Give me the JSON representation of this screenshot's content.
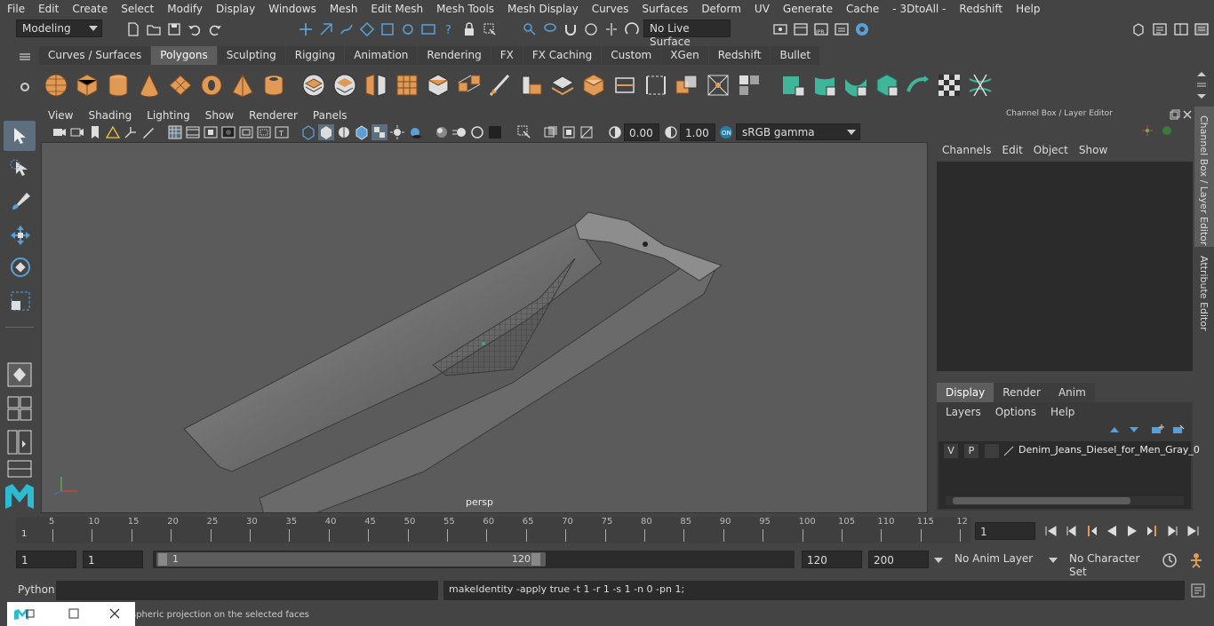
{
  "menubar": {
    "items": [
      "File",
      "Edit",
      "Create",
      "Select",
      "Modify",
      "Display",
      "Windows",
      "Mesh",
      "Edit Mesh",
      "Mesh Tools",
      "Mesh Display",
      "Curves",
      "Surfaces",
      "Deform",
      "UV",
      "Generate",
      "Cache",
      "- 3DtoAll -",
      "Redshift",
      "Help"
    ]
  },
  "toolbar": {
    "mode": "Modeling",
    "live_surface": "No Live Surface"
  },
  "shelf": {
    "tabs": [
      "Curves / Surfaces",
      "Polygons",
      "Sculpting",
      "Rigging",
      "Animation",
      "Rendering",
      "FX",
      "FX Caching",
      "Custom",
      "XGen",
      "Redshift",
      "Bullet"
    ],
    "active": "Polygons"
  },
  "viewport": {
    "menu": [
      "View",
      "Shading",
      "Lighting",
      "Show",
      "Renderer",
      "Panels"
    ],
    "exposure": "0.00",
    "gamma": "1.00",
    "colorspace": "sRGB gamma",
    "camera_label": "persp"
  },
  "channel_box": {
    "title": "Channel Box / Layer Editor",
    "menu": [
      "Channels",
      "Edit",
      "Object",
      "Show"
    ],
    "side_tabs": [
      "Channel Box / Layer Editor",
      "Attribute Editor"
    ]
  },
  "layer_editor": {
    "tabs": [
      "Display",
      "Render",
      "Anim"
    ],
    "active_tab": "Display",
    "menu": [
      "Layers",
      "Options",
      "Help"
    ],
    "layer": {
      "v": "V",
      "p": "P",
      "name": "Denim_Jeans_Diesel_for_Men_Gray_0"
    }
  },
  "timeline": {
    "ticks": [
      "5",
      "10",
      "15",
      "20",
      "25",
      "30",
      "35",
      "40",
      "45",
      "50",
      "55",
      "60",
      "65",
      "70",
      "75",
      "80",
      "85",
      "90",
      "95",
      "100",
      "105",
      "110",
      "115",
      "12"
    ],
    "start_mark": "1",
    "current_frame": "1"
  },
  "range": {
    "start": "1",
    "playback_start": "1",
    "slider_start": "1",
    "slider_end": "120",
    "playback_end": "120",
    "end": "200",
    "anim_layer": "No Anim Layer",
    "character_set": "No Character Set"
  },
  "command": {
    "language": "Python",
    "input": "",
    "result": "makeIdentity -apply true -t 1 -r 1 -s 1 -n 0 -pn 1;"
  },
  "help_line": {
    "text": "spheric projection on the selected faces"
  },
  "colors": {
    "ui_bg": "#444444",
    "viewport_bg": "#5b5b5b",
    "shelf_orange": "#e09a55",
    "shelf_teal": "#3fb59a",
    "accent_blue": "#5285a6"
  }
}
